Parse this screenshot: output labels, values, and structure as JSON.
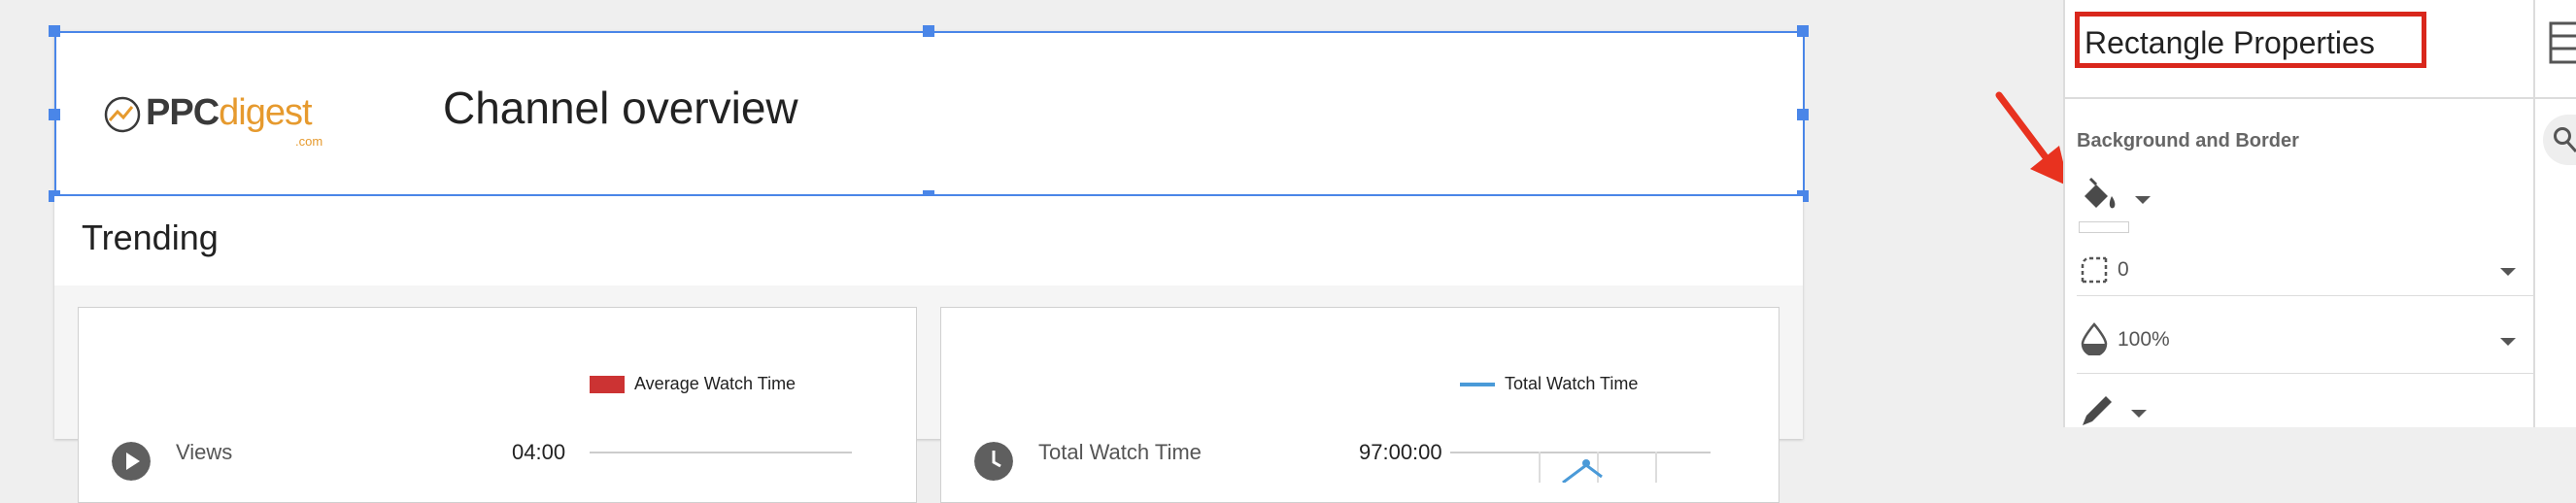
{
  "report": {
    "logo": {
      "text_main": "PPC",
      "text_accent": "digest",
      "text_suffix": ".com"
    },
    "header_title": "Channel overview",
    "section_title": "Trending",
    "cards": [
      {
        "legend_label": "Average Watch Time",
        "metric_label": "Views",
        "metric_value": "04:00",
        "icon": "play-circle-icon"
      },
      {
        "legend_label": "Total Watch Time",
        "metric_label": "Total Watch Time",
        "metric_value": "97:00:00",
        "icon": "clock-icon"
      }
    ]
  },
  "properties_panel": {
    "title": "Rectangle Properties",
    "section": "Background and Border",
    "rows": [
      {
        "icon": "fill-color-icon",
        "value": ""
      },
      {
        "icon": "border-radius-icon",
        "value": "0"
      },
      {
        "icon": "opacity-icon",
        "value": "100%"
      },
      {
        "icon": "border-color-icon",
        "value": ""
      }
    ]
  },
  "annotation": {
    "arrow_color": "#e8321f",
    "box_color": "#d9271c"
  },
  "colors": {
    "selection": "#4a86e8",
    "bar_series": "#cc3333",
    "line_series": "#4a9ad8",
    "logo_accent": "#e69a2e"
  },
  "side_rail": {
    "icons": [
      "list-icon",
      "search-icon"
    ]
  }
}
